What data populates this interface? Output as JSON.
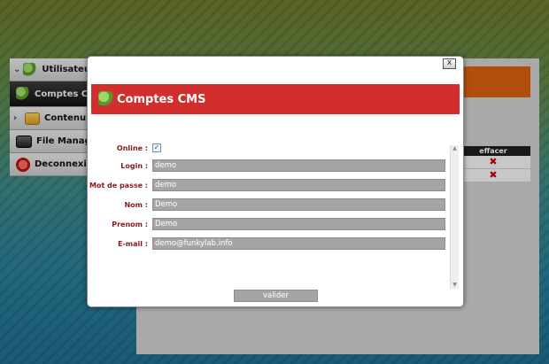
{
  "sidebar": {
    "items": [
      {
        "label": "Utilisateur",
        "icon": "users-icon",
        "expanded": true
      },
      {
        "label": "Comptes CMS",
        "icon": "users-icon",
        "active": true
      },
      {
        "label": "Contenu",
        "icon": "folder-icon"
      },
      {
        "label": "File Manager",
        "icon": "drive-icon"
      },
      {
        "label": "Deconnexion",
        "icon": "power-icon"
      }
    ]
  },
  "background_table": {
    "header": "effacer",
    "rows": [
      "✖",
      "✖"
    ]
  },
  "modal": {
    "close_label": "x",
    "title": "Comptes CMS",
    "fields": {
      "online": {
        "label": "Online :",
        "checked": true,
        "mark": "✓"
      },
      "login": {
        "label": "Login :",
        "value": "demo"
      },
      "password": {
        "label": "Mot de passe :",
        "value": "demo"
      },
      "nom": {
        "label": "Nom :",
        "value": "Demo"
      },
      "prenom": {
        "label": "Prenom :",
        "value": "Demo"
      },
      "email": {
        "label": "E-mail :",
        "value": "demo@funkylab.info"
      }
    },
    "submit_label": "valider"
  },
  "colors": {
    "header_red": "#d22e2e",
    "label_red": "#8a1a1a",
    "field_gray": "#a5a5a5",
    "accent_orange": "#d9600f"
  }
}
